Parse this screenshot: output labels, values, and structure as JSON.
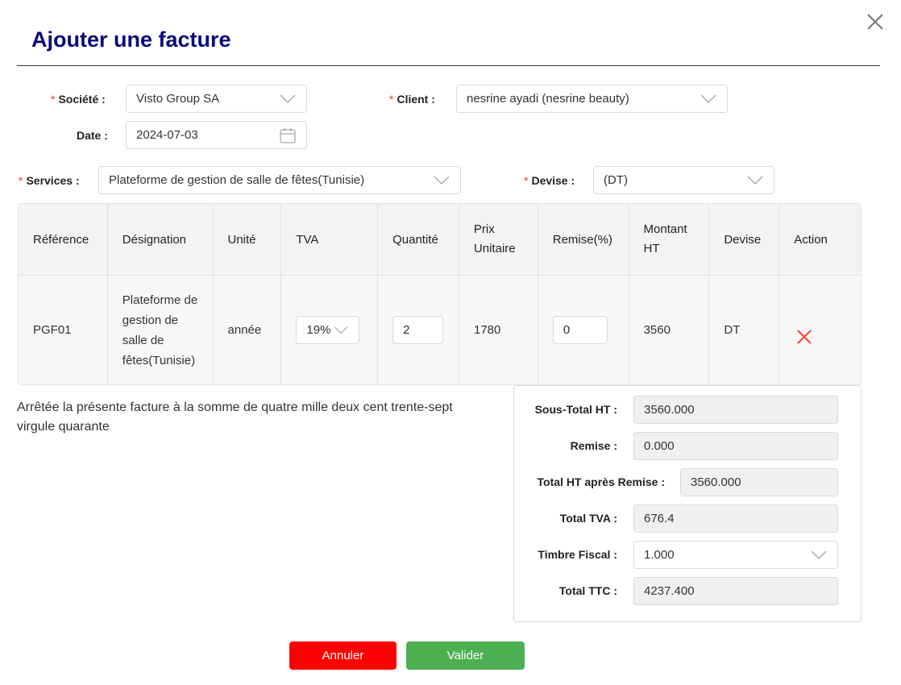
{
  "dialog": {
    "title": "Ajouter une facture",
    "close_icon": "close-icon"
  },
  "form": {
    "societe": {
      "label": "Société",
      "value": "Visto Group SA"
    },
    "client": {
      "label": "Client",
      "value": "nesrine ayadi (nesrine beauty)"
    },
    "date": {
      "label": "Date",
      "value": "2024-07-03"
    },
    "services": {
      "label": "Services",
      "value": "Plateforme de gestion de salle de fêtes(Tunisie)"
    },
    "devise": {
      "label": "Devise",
      "value": "(DT)"
    },
    "required_mark": "*",
    "colon": ":"
  },
  "table": {
    "headers": [
      "Référence",
      "Désignation",
      "Unité",
      "TVA",
      "Quantité",
      "Prix Unitaire",
      "Remise(%)",
      "Montant HT",
      "Devise",
      "Action"
    ],
    "rows": [
      {
        "reference": "PGF01",
        "designation": "Plateforme de gestion de salle de fêtes(Tunisie)",
        "unite": "année",
        "tva": "19%",
        "quantite": "2",
        "prix_unitaire": "1780",
        "remise": "0",
        "montant_ht": "3560",
        "devise": "DT"
      }
    ]
  },
  "amount_in_words": "Arrêtée la présente facture à la somme de quatre mille deux cent trente-sept virgule quarante",
  "totals": {
    "sous_total_ht": {
      "label": "Sous-Total HT",
      "value": "3560.000"
    },
    "remise": {
      "label": "Remise",
      "value": "0.000"
    },
    "total_ht_apres_remise": {
      "label": "Total HT après Remise",
      "value": "3560.000"
    },
    "total_tva": {
      "label": "Total TVA",
      "value": "676.4"
    },
    "timbre_fiscal": {
      "label": "Timbre Fiscal",
      "value": "1.000"
    },
    "total_ttc": {
      "label": "Total TTC",
      "value": "4237.400"
    }
  },
  "buttons": {
    "cancel": "Annuler",
    "submit": "Valider"
  },
  "colors": {
    "title": "#0a0a7a",
    "required": "#e53935",
    "cancel": "#fd0100",
    "submit": "#4caf50",
    "delete": "#f44336"
  }
}
